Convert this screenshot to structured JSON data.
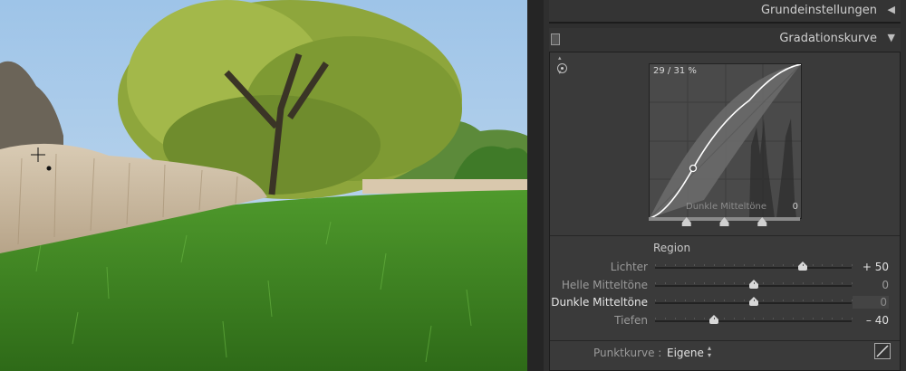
{
  "panel": {
    "sections": {
      "basic": {
        "title": "Grundeinstellungen"
      },
      "tone_curve": {
        "title": "Gradationskurve"
      }
    },
    "curve": {
      "readout": "29 / 31 %",
      "hover_region": "Dunkle Mitteltöne",
      "corner_value": "0",
      "split_points": [
        0.25,
        0.5,
        0.75
      ]
    },
    "region": {
      "label": "Region",
      "sliders": [
        {
          "label": "Lichter",
          "value_text": "+ 50",
          "value": 50
        },
        {
          "label": "Helle Mitteltöne",
          "value_text": "0",
          "value": 0
        },
        {
          "label": "Dunkle Mitteltöne",
          "value_text": "0",
          "value": 0
        },
        {
          "label": "Tiefen",
          "value_text": "– 40",
          "value": -40
        }
      ]
    },
    "point_curve": {
      "label": "Punktkurve :",
      "value": "Eigene"
    }
  },
  "icons": {
    "collapse": "triangle-left-icon",
    "expand": "triangle-down-icon",
    "targeted_adjustment": "target-icon",
    "point_curve_edit": "curve-edit-icon"
  }
}
